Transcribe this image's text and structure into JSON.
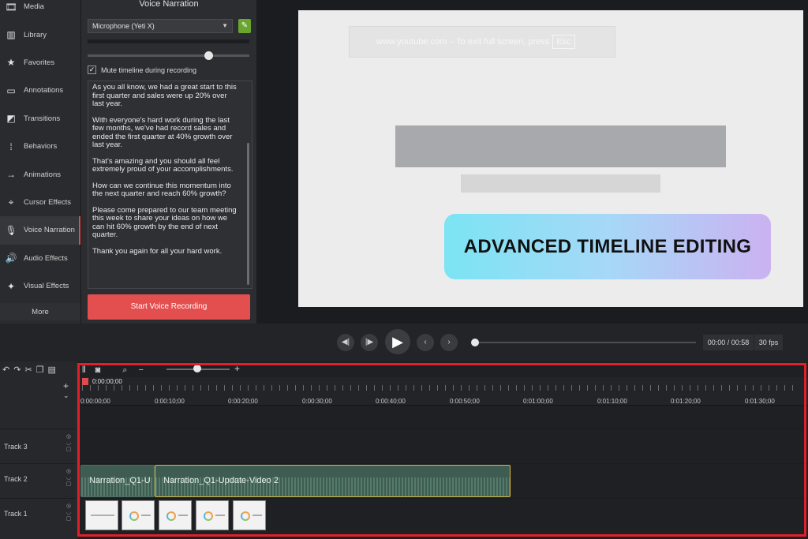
{
  "sidebar": {
    "items": [
      {
        "label": "Media",
        "icon": "film-icon"
      },
      {
        "label": "Library",
        "icon": "library-icon"
      },
      {
        "label": "Favorites",
        "icon": "star-icon"
      },
      {
        "label": "Annotations",
        "icon": "annotation-icon"
      },
      {
        "label": "Transitions",
        "icon": "transition-icon"
      },
      {
        "label": "Behaviors",
        "icon": "behavior-icon"
      },
      {
        "label": "Animations",
        "icon": "animation-icon"
      },
      {
        "label": "Cursor Effects",
        "icon": "cursor-icon"
      },
      {
        "label": "Voice Narration",
        "icon": "microphone-icon",
        "active": true
      },
      {
        "label": "Audio Effects",
        "icon": "speaker-icon"
      },
      {
        "label": "Visual Effects",
        "icon": "wand-icon"
      }
    ],
    "more_label": "More"
  },
  "narration": {
    "title": "Voice Narration",
    "mic_select": "Microphone (Yeti X)",
    "mute_label": "Mute timeline during recording",
    "mute_checked": true,
    "script_paragraphs": [
      "As you all know, we had a great start to this first quarter and sales were up 20% over last year.",
      "With everyone's hard work during the last few months, we've had record sales and ended the first quarter at 40% growth over last year.",
      "That's amazing and you should all feel extremely proud of your accomplishments.",
      "How can we continue this momentum into the next quarter and reach 60% growth?",
      "Please come prepared to our team meeting this week to share your ideas on how we can hit 60% growth by the end of next quarter.",
      "Thank you again for all your hard work."
    ],
    "record_button": "Start Voice Recording"
  },
  "preview": {
    "esc_text": "www.youtube.com – To exit full screen, press",
    "esc_key": "Esc",
    "badge": "ADVANCED TIMELINE EDITING"
  },
  "playback": {
    "time": "00:00 / 00:58",
    "fps": "30 fps"
  },
  "timeline": {
    "playhead_time": "0:00:00;00",
    "ticks": [
      "0:00:00;00",
      "0:00:10;00",
      "0:00:20;00",
      "0:00:30;00",
      "0:00:40;00",
      "0:00:50;00",
      "0:01:00;00",
      "0:01:10;00",
      "0:01:20;00",
      "0:01:30;00"
    ],
    "tracks": [
      {
        "label": "Track 3"
      },
      {
        "label": "Track 2"
      },
      {
        "label": "Track 1"
      }
    ],
    "clips": {
      "audio1": "Narration_Q1-U",
      "audio2": "Narration_Q1-Update-Video 2"
    }
  },
  "colors": {
    "accent": "#e34e4e",
    "frame": "#e0202b",
    "audio_clip": "#3f5c52",
    "selected_clip_border": "#d4b945"
  }
}
